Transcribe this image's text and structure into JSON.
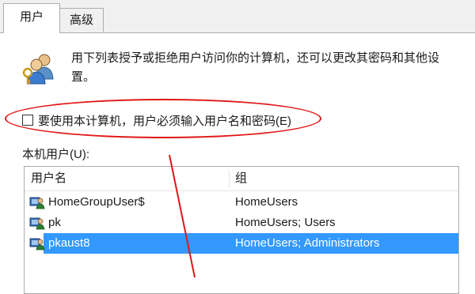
{
  "tabs": [
    {
      "label": "用户",
      "active": true
    },
    {
      "label": "高级",
      "active": false
    }
  ],
  "description": "用下列表授予或拒绝用户访问你的计算机，还可以更改其密码和其他设置。",
  "checkbox": {
    "label": "要使用本计算机，用户必须输入用户名和密码(E)",
    "checked": false
  },
  "users_list": {
    "label": "本机用户(U):",
    "columns": [
      "用户名",
      "组"
    ],
    "rows": [
      {
        "name": "HomeGroupUser$",
        "group": "HomeUsers",
        "selected": false
      },
      {
        "name": "pk",
        "group": "HomeUsers; Users",
        "selected": false
      },
      {
        "name": "pkaust8",
        "group": "HomeUsers; Administrators",
        "selected": true
      }
    ]
  },
  "icons": {
    "header": "users-key-icon",
    "row": "user-icon"
  },
  "colors": {
    "selection": "#3399ff",
    "annotation": "#e01818"
  }
}
